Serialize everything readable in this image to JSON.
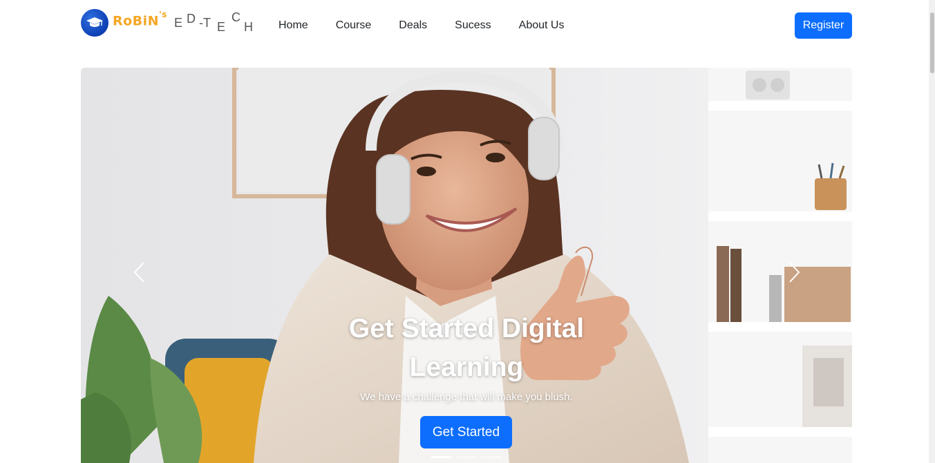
{
  "brand": {
    "name": "RoBiN",
    "suffix": "'s",
    "tagline_letters": [
      "E",
      "D",
      "-T",
      "E",
      "C",
      "H"
    ]
  },
  "nav": {
    "items": [
      {
        "label": "Home"
      },
      {
        "label": "Course"
      },
      {
        "label": "Deals"
      },
      {
        "label": "Sucess"
      },
      {
        "label": "About Us"
      }
    ],
    "register_label": "Register"
  },
  "hero": {
    "title_line1": "Get Started Digital",
    "title_line2": "Learning",
    "subtitle": "We have a challenge that will make you blush.",
    "cta_label": "Get Started",
    "active_slide": 1,
    "slide_count": 3
  },
  "colors": {
    "primary": "#0d6efd",
    "brand_orange": "#f5a623",
    "logo_blue": "#0d3fb3"
  },
  "icons": [
    "graduation-cap-icon",
    "chevron-left-icon",
    "chevron-right-icon"
  ]
}
